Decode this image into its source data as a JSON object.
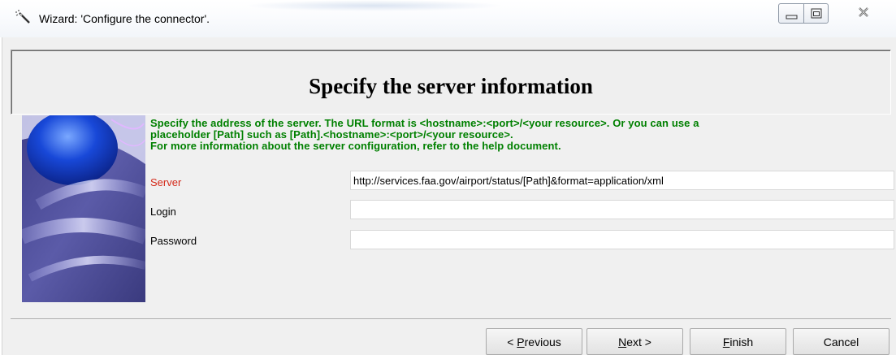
{
  "window": {
    "title": "Wizard: 'Configure the connector'.",
    "icon": "wand-icon",
    "controls": [
      "minimize-icon",
      "maximize-icon",
      "close-icon"
    ]
  },
  "header": {
    "title": "Specify the server information"
  },
  "description": "Specify the address of the server. The URL format is <hostname>:<port>/<your resource>. Or you can use a\nplaceholder [Path] such as [Path].<hostname>:<port>/<your resource>.\nFor more information about the server configuration, refer to the help document.",
  "form": {
    "server_label": "Server",
    "server_value": "http://services.faa.gov/airport/status/[Path]&format=application/xml",
    "login_label": "Login",
    "login_value": "",
    "password_label": "Password",
    "password_value": ""
  },
  "buttons": {
    "previous": {
      "prefix": "< ",
      "accel": "P",
      "rest": "revious"
    },
    "next": {
      "accel": "N",
      "rest": "ext >"
    },
    "finish": {
      "accel": "F",
      "rest": "inish"
    },
    "cancel": "Cancel"
  },
  "colors": {
    "description_text": "#008000",
    "required_label": "#d42a1a",
    "dialog_background": "#f0f0f0"
  }
}
